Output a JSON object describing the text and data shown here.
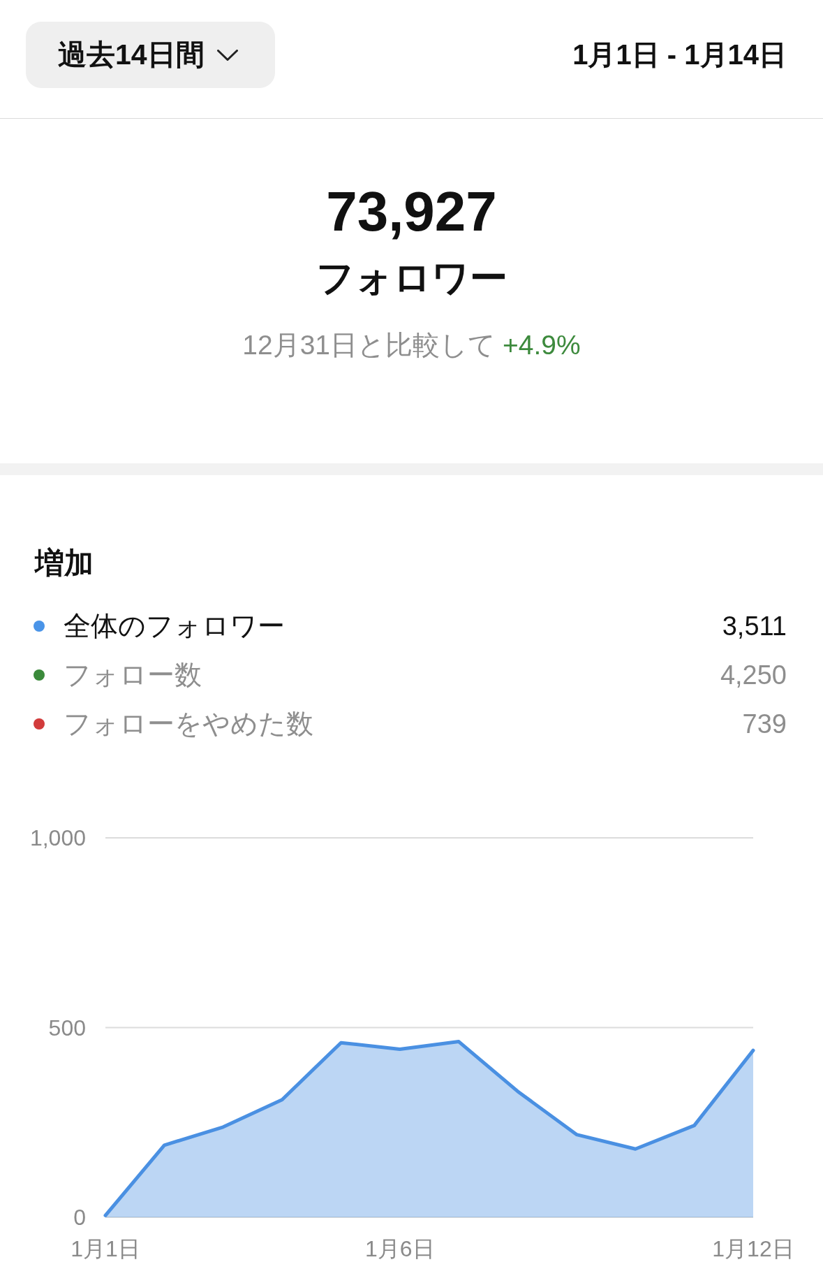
{
  "header": {
    "period_dropdown": {
      "label": "過去14日間"
    },
    "date_range": "1月1日 - 1月14日"
  },
  "summary": {
    "total": "73,927",
    "label": "フォロワー",
    "comparison": {
      "text": "12月31日と比較して",
      "change": "+4.9%"
    }
  },
  "growth": {
    "title": "増加",
    "legend": [
      {
        "label": "全体のフォロワー",
        "value": "3,511",
        "color": "#4a94e8",
        "selected": true
      },
      {
        "label": "フォロー数",
        "value": "4,250",
        "color": "#3b8a3b",
        "selected": false
      },
      {
        "label": "フォローをやめた数",
        "value": "739",
        "color": "#d23b3b",
        "selected": false
      }
    ],
    "chart_data": {
      "type": "area",
      "categories": [
        "1月1日",
        null,
        null,
        null,
        null,
        "1月6日",
        null,
        null,
        null,
        null,
        null,
        "1月12日"
      ],
      "series": [
        {
          "color": "#4a90e2",
          "values": [
            5,
            190,
            238,
            310,
            460,
            443,
            463,
            332,
            218,
            180,
            242,
            440
          ]
        }
      ],
      "ylim": [
        0,
        1000
      ],
      "yticks": [
        0,
        500,
        {
          "value": 1000,
          "label": "1,000"
        }
      ]
    }
  }
}
